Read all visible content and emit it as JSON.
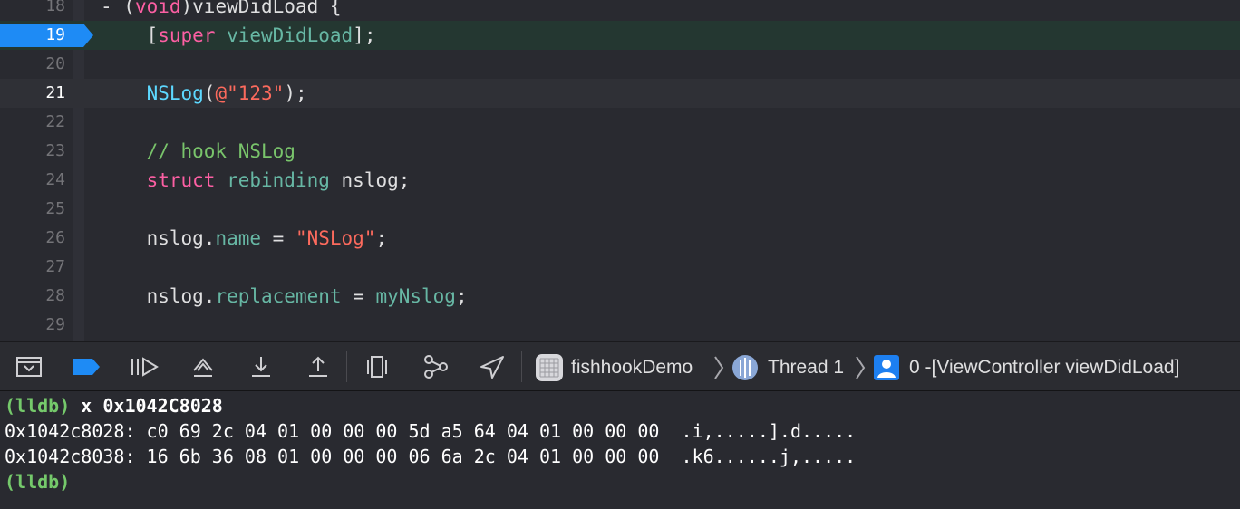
{
  "editor": {
    "lines": [
      {
        "num": "18",
        "parts": [
          {
            "t": "- (",
            "c": ""
          },
          {
            "t": "void",
            "c": "kw"
          },
          {
            "t": ")viewDidLoad {",
            "c": ""
          }
        ]
      },
      {
        "num": "19",
        "parts": [
          {
            "t": "    [",
            "c": ""
          },
          {
            "t": "super",
            "c": "kw"
          },
          {
            "t": " ",
            "c": ""
          },
          {
            "t": "viewDidLoad",
            "c": "tok-fn"
          },
          {
            "t": "];",
            "c": ""
          }
        ]
      },
      {
        "num": "20",
        "parts": []
      },
      {
        "num": "21",
        "parts": [
          {
            "t": "    ",
            "c": ""
          },
          {
            "t": "NSLog",
            "c": "tok-fn2"
          },
          {
            "t": "(",
            "c": ""
          },
          {
            "t": "@\"123\"",
            "c": "tok-str"
          },
          {
            "t": ");",
            "c": ""
          }
        ]
      },
      {
        "num": "22",
        "parts": []
      },
      {
        "num": "23",
        "parts": [
          {
            "t": "    ",
            "c": ""
          },
          {
            "t": "// hook NSLog",
            "c": "tok-green"
          }
        ]
      },
      {
        "num": "24",
        "parts": [
          {
            "t": "    ",
            "c": ""
          },
          {
            "t": "struct",
            "c": "kw"
          },
          {
            "t": " ",
            "c": ""
          },
          {
            "t": "rebinding",
            "c": "tok-fn"
          },
          {
            "t": " nslog;",
            "c": ""
          }
        ]
      },
      {
        "num": "25",
        "parts": []
      },
      {
        "num": "26",
        "parts": [
          {
            "t": "    nslog.",
            "c": ""
          },
          {
            "t": "name",
            "c": "tok-prop"
          },
          {
            "t": " = ",
            "c": ""
          },
          {
            "t": "\"NSLog\"",
            "c": "tok-str"
          },
          {
            "t": ";",
            "c": ""
          }
        ]
      },
      {
        "num": "27",
        "parts": []
      },
      {
        "num": "28",
        "parts": [
          {
            "t": "    nslog.",
            "c": ""
          },
          {
            "t": "replacement",
            "c": "tok-prop"
          },
          {
            "t": " = ",
            "c": ""
          },
          {
            "t": "myNslog",
            "c": "tok-fn"
          },
          {
            "t": ";",
            "c": ""
          }
        ]
      },
      {
        "num": "29",
        "parts": []
      }
    ],
    "execution_line": "19",
    "current_line": "21"
  },
  "debug_bar": {
    "buttons": [
      {
        "name": "hide-debug-area-icon",
        "label": "Hide debug area"
      },
      {
        "name": "breakpoints-toggle-icon",
        "label": "Activate breakpoints"
      },
      {
        "name": "continue-icon",
        "label": "Continue"
      },
      {
        "name": "step-over-icon",
        "label": "Step over"
      },
      {
        "name": "step-into-icon",
        "label": "Step into"
      },
      {
        "name": "step-out-icon",
        "label": "Step out"
      },
      {
        "name": "debug-view-hierarchy-icon",
        "label": "Debug view hierarchy"
      },
      {
        "name": "debug-memory-graph-icon",
        "label": "Debug memory graph"
      },
      {
        "name": "simulate-location-icon",
        "label": "Simulate location"
      }
    ],
    "breadcrumb": {
      "app": "fishhookDemo",
      "thread": "Thread 1",
      "frame": "0 -[ViewController viewDidLoad]"
    }
  },
  "console": {
    "prompt": "(lldb)",
    "command": " x 0x1042C8028",
    "output": [
      "0x1042c8028: c0 69 2c 04 01 00 00 00 5d a5 64 04 01 00 00 00  .i,.....].d.....",
      "0x1042c8038: 16 6b 36 08 01 00 00 00 06 6a 2c 04 01 00 00 00  .k6......j,....."
    ],
    "prompt2": "(lldb)"
  },
  "colors": {
    "background": "#292a30",
    "keyword": "#fc5fa3",
    "string": "#fc6a5d",
    "comment": "#79c46b",
    "function": "#67b7a4",
    "breakpoint_blue": "#1e8bf5",
    "prompt": "#75c96b"
  }
}
